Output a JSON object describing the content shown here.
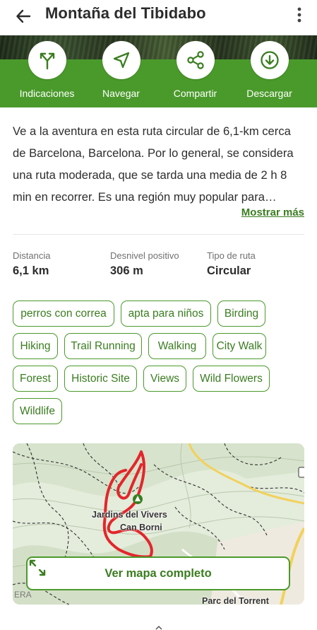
{
  "header": {
    "title": "Montaña del Tibidabo",
    "back_icon": "arrow-left-icon",
    "more_icon": "more-vertical-icon"
  },
  "actions": [
    {
      "label": "Indicaciones",
      "icon": "directions-icon"
    },
    {
      "label": "Navegar",
      "icon": "navigate-icon"
    },
    {
      "label": "Compartir",
      "icon": "share-icon"
    },
    {
      "label": "Descargar",
      "icon": "download-icon"
    }
  ],
  "description": {
    "text": "Ve a la aventura en esta ruta circular de 6,1-km cerca de Barcelona, Barcelona. Por lo general, se considera una ruta moderada, que se tarda una media de 2 h 8 min en recorrer. Es una región muy popular para practicar senderismo, por lo que es probable que te encuentres con otras personas mientras exploras.",
    "show_more": "Mostrar más"
  },
  "stats": [
    {
      "label": "Distancia",
      "value": "6,1 km"
    },
    {
      "label": "Desnivel positivo",
      "value": "306 m"
    },
    {
      "label": "Tipo de ruta",
      "value": "Circular"
    }
  ],
  "tags": [
    "perros con correa",
    "apta para niños",
    "Birding",
    "Hiking",
    "Trail Running",
    "Walking",
    "City Walk",
    "Forest",
    "Historic Site",
    "Views",
    "Wild Flowers",
    "Wildlife"
  ],
  "map": {
    "label_1": "Jardins del Vivers",
    "label_2": "Can Borni",
    "label_3": "Parc del Torrent",
    "attribution": "ERA",
    "button_label": "Ver mapa completo",
    "expand_icon": "expand-icon"
  },
  "colors": {
    "brand_green": "#4a9a2b",
    "link_green": "#3a7d20",
    "route_red": "#e3262b"
  }
}
